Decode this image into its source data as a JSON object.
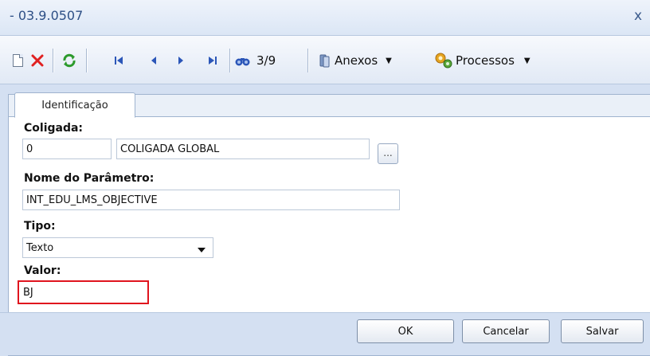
{
  "window": {
    "title": "- 03.9.0507",
    "close_glyph": "x"
  },
  "toolbar": {
    "record_counter": "3/9",
    "anexos_label": "Anexos",
    "processos_label": "Processos",
    "icons": [
      "new-document-icon",
      "delete-icon",
      "refresh-icon",
      "first-record-icon",
      "previous-record-icon",
      "next-record-icon",
      "last-record-icon",
      "search-icon",
      "attachment-icon",
      "processes-icon"
    ]
  },
  "tabs": [
    {
      "label": "Identificação",
      "active": true
    }
  ],
  "form": {
    "coligada": {
      "label": "Coligada:",
      "code": "0",
      "name": "COLIGADA GLOBAL",
      "lookup_glyph": "..."
    },
    "nome_parametro": {
      "label": "Nome do Parâmetro:",
      "value": "INT_EDU_LMS_OBJECTIVE"
    },
    "tipo": {
      "label": "Tipo:",
      "value": "Texto"
    },
    "valor": {
      "label": "Valor:",
      "value": "BJ"
    }
  },
  "buttons": {
    "ok": "OK",
    "cancel": "Cancelar",
    "save": "Salvar"
  },
  "colors": {
    "highlight": "#e0141e",
    "title_text": "#2d4f86",
    "delete_red": "#e02020",
    "refresh_green": "#2c9a2c",
    "nav_blue": "#2b56b8"
  }
}
